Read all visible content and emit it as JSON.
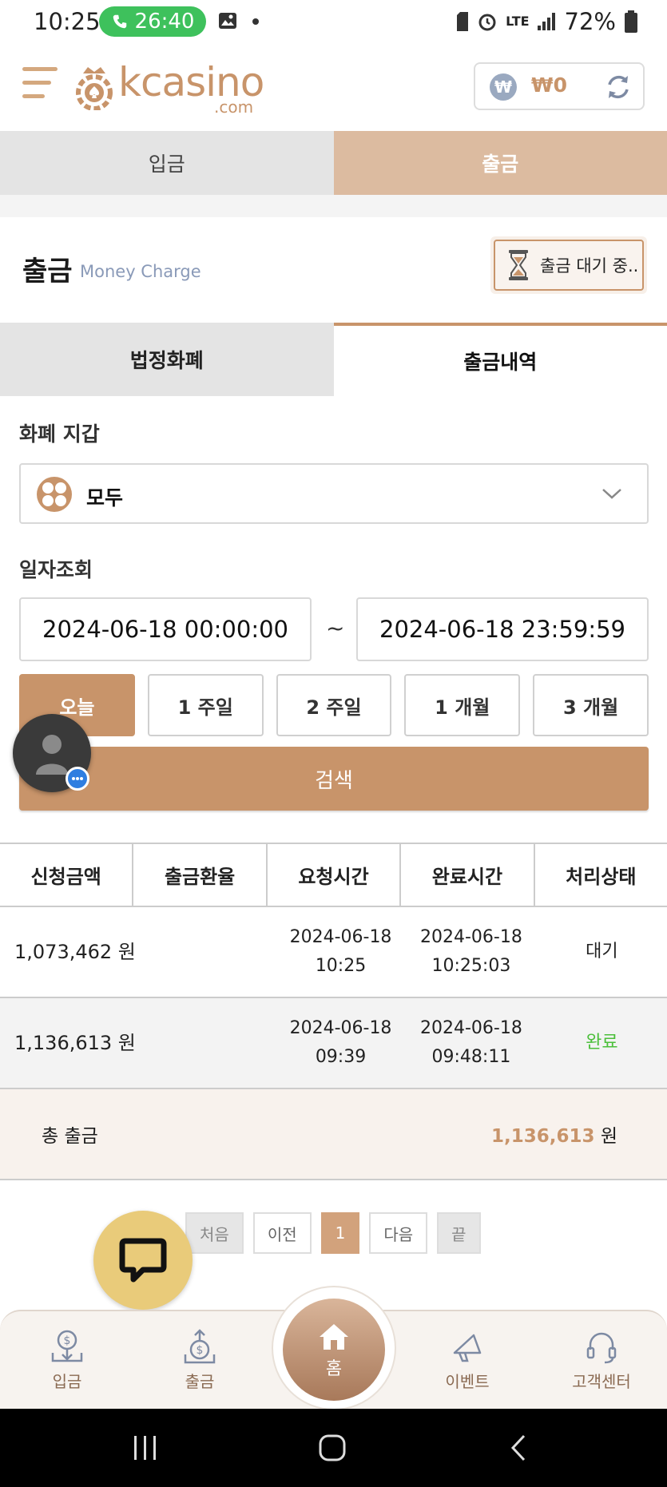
{
  "status_bar": {
    "time": "10:25",
    "call_duration": "26:40",
    "battery": "72%",
    "network": "LTE"
  },
  "header": {
    "logo_text": "kcasino",
    "logo_domain": ".com",
    "balance": "₩0",
    "currency_symbol": "₩"
  },
  "top_tabs": {
    "deposit": "입금",
    "withdraw": "출금"
  },
  "section": {
    "title": "출금",
    "subtitle": "Money Charge",
    "pending_label": "출금 대기 중.."
  },
  "sub_tabs": {
    "fiat": "법정화폐",
    "history": "출금내역"
  },
  "wallet": {
    "label": "화폐 지갑",
    "selected": "모두"
  },
  "date_search": {
    "label": "일자조회",
    "start": "2024-06-18 00:00:00",
    "end": "2024-06-18 23:59:59",
    "separator": "~",
    "periods": [
      "오늘",
      "1 주일",
      "2 주일",
      "1 개월",
      "3 개월"
    ],
    "search_label": "검색"
  },
  "table": {
    "headers": [
      "신청금액",
      "출금환율",
      "요청시간",
      "완료시간",
      "처리상태"
    ],
    "rows": [
      {
        "amount": "1,073,462 원",
        "rate": "",
        "req_date": "2024-06-18",
        "req_time": "10:25",
        "done_date": "2024-06-18",
        "done_time": "10:25:03",
        "status": "대기"
      },
      {
        "amount": "1,136,613 원",
        "rate": "",
        "req_date": "2024-06-18",
        "req_time": "09:39",
        "done_date": "2024-06-18",
        "done_time": "09:48:11",
        "status": "완료"
      }
    ],
    "total_label": "총 출금",
    "total_value": "1,136,613",
    "total_unit": "원"
  },
  "pagination": {
    "first": "처음",
    "prev": "이전",
    "current": "1",
    "next": "다음",
    "last": "끝"
  },
  "bottom_nav": {
    "deposit": "입금",
    "withdraw": "출금",
    "home": "홈",
    "event": "이벤트",
    "support": "고객센터"
  },
  "colors": {
    "accent": "#c8946a",
    "tab_active": "#dcbba0",
    "done_status": "#4bbf3a",
    "call_pill": "#3ec15c"
  }
}
